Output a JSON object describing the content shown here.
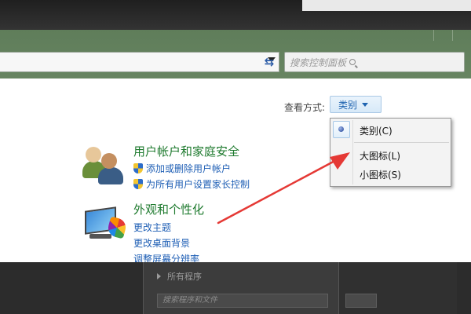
{
  "search": {
    "placeholder": "搜索控制面板"
  },
  "viewby": {
    "label": "查看方式:",
    "current": "类别"
  },
  "categories": [
    {
      "title": "用户帐户和家庭安全",
      "links": [
        "添加或删除用户帐户",
        "为所有用户设置家长控制"
      ]
    },
    {
      "title": "外观和个性化",
      "links": [
        "更改主题",
        "更改桌面背景",
        "调整屏幕分辨率"
      ]
    }
  ],
  "menu": {
    "items": [
      "类别(C)",
      "大图标(L)",
      "小图标(S)"
    ],
    "selected_index": 0
  },
  "start_menu": {
    "all_programs": "所有程序",
    "search_placeholder": "搜索程序和文件"
  },
  "colors": {
    "category_title": "#1e7a2e",
    "link": "#1f5fb5",
    "arrow": "#e53935"
  }
}
